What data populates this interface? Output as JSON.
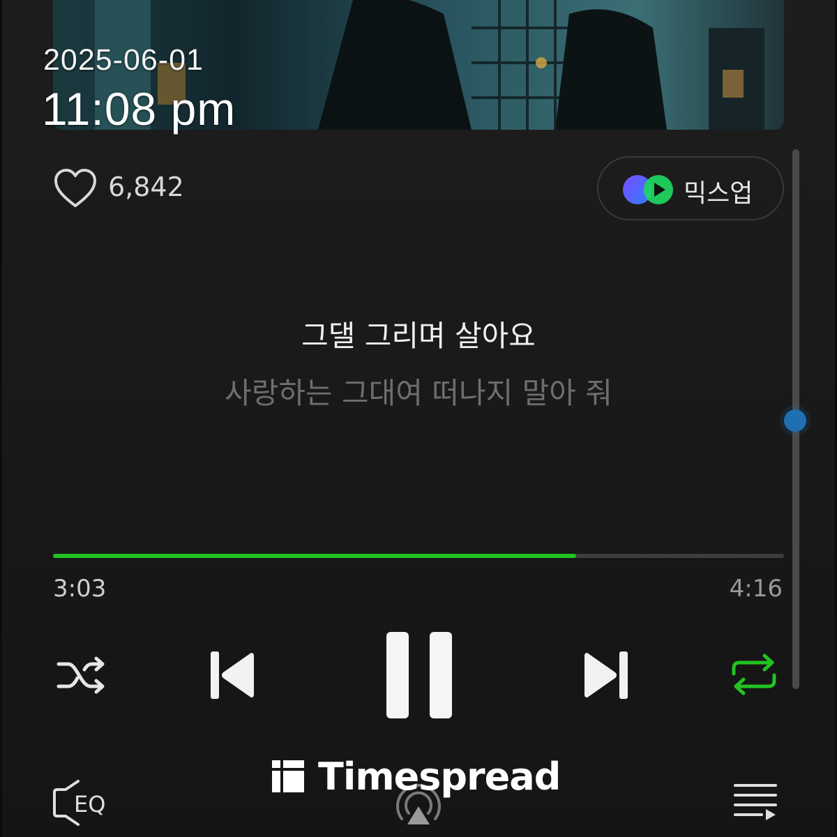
{
  "overlay": {
    "date": "2025-06-01",
    "time": "11:08 pm"
  },
  "track": {
    "like_count": "6,842",
    "mixup_label": "믹스업",
    "lyric_current": "그댈 그리며 살아요",
    "lyric_next": "사랑하는 그대여 떠나지 말아 줘"
  },
  "player": {
    "elapsed": "3:03",
    "total": "4:16",
    "progress_fraction": 0.716,
    "shuffle_on": false,
    "repeat_on": true,
    "state": "playing"
  },
  "bottom_bar": {
    "eq_label": "EQ"
  },
  "watermark": {
    "text": "Timespread"
  },
  "colors": {
    "accent_green": "#22c322",
    "scroll_thumb": "#1f6fb2",
    "background": "#1a1a1a"
  },
  "icons": {
    "like": "heart-outline-icon",
    "mixup": "mixup-logo-icon",
    "shuffle": "shuffle-icon",
    "previous": "skip-previous-icon",
    "pause": "pause-icon",
    "next": "skip-next-icon",
    "repeat": "repeat-icon",
    "eq": "eq-icon",
    "cast": "airplay-icon",
    "playlist": "playlist-icon"
  }
}
